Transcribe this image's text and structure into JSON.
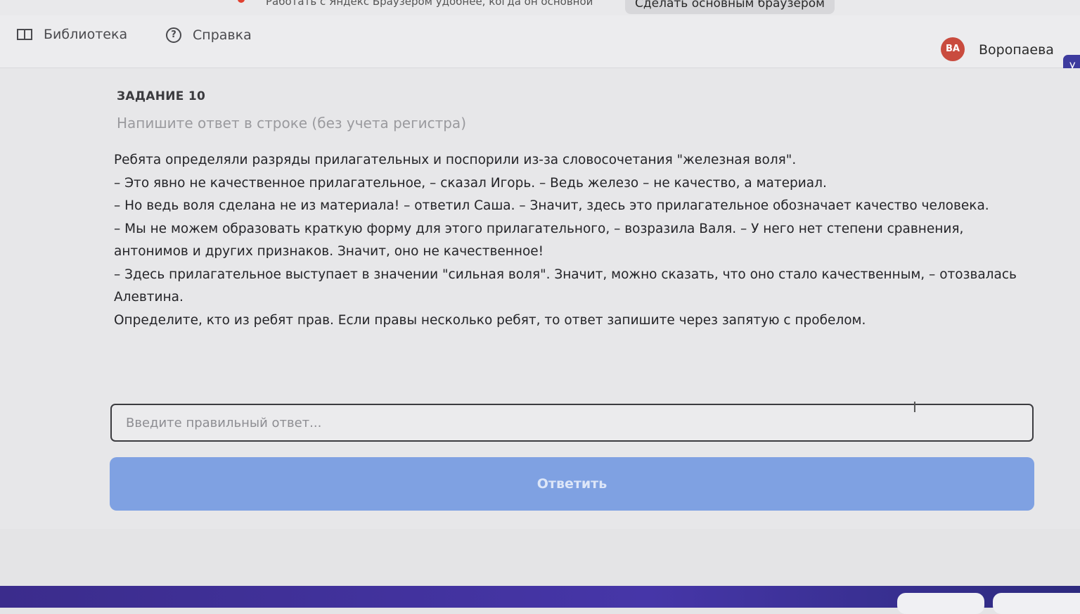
{
  "browser": {
    "notice_text": "Работать с Яндекс Браузером удобнее, когда он основной",
    "make_default_label": "Сделать основным браузером"
  },
  "header": {
    "library_label": "Библиотека",
    "help_label": "Справка",
    "avatar_initials": "ВА",
    "user_name": "Воропаева",
    "user_extra": "У",
    "icons": [
      "book-icon",
      "help-icon"
    ]
  },
  "task": {
    "number": "ЗАДАНИЕ 10",
    "instruction": "Напишите ответ в строке (без учета регистра)",
    "paragraphs": [
      "Ребята определяли разряды прилагательных и поспорили из-за словосочетания \"железная воля\".",
      "– Это явно не качественное прилагательное, – сказал Игорь. – Ведь железо – не качество, а материал.",
      "– Но ведь воля сделана не из материала! – ответил Саша. – Значит, здесь это прилагательное обозначает качество человека.",
      "– Мы не можем образовать краткую форму для этого прилагательного, – возразила Валя. – У него нет степени сравнения, антонимов и других признаков. Значит, оно не качественное!",
      "– Здесь прилагательное выступает в значении \"сильная воля\". Значит, можно сказать, что оно стало качественным, – отозвалась Алевтина.",
      "Определите, кто из ребят прав. Если правы несколько ребят, то ответ запишите через запятую с пробелом."
    ]
  },
  "answer": {
    "placeholder": "Введите правильный ответ...",
    "value": "",
    "submit_label": "Ответить"
  },
  "colors": {
    "submit_bg": "#7fa1e2",
    "avatar_bg": "#c94b3e",
    "footer_bg": "#3b2c8c"
  }
}
